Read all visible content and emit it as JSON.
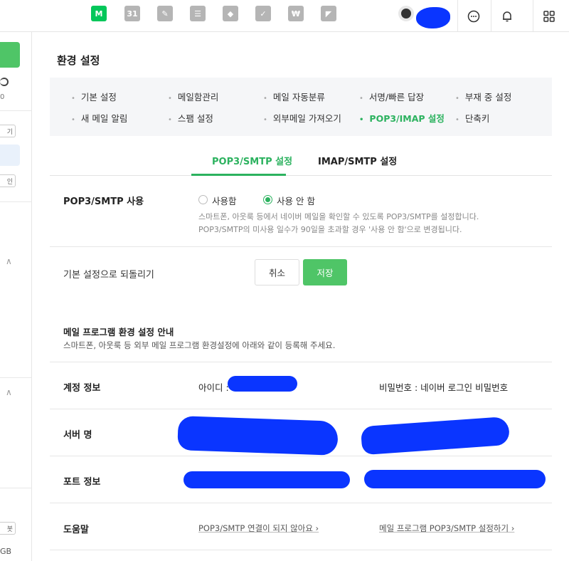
{
  "topbar": {
    "apps": [
      {
        "name": "mail",
        "glyph": "M"
      },
      {
        "name": "calendar",
        "glyph": "31"
      },
      {
        "name": "memo",
        "glyph": "✎"
      },
      {
        "name": "contacts",
        "glyph": "☰"
      },
      {
        "name": "mybox",
        "glyph": "◆"
      },
      {
        "name": "todo",
        "glyph": "✓"
      },
      {
        "name": "pay",
        "glyph": "₩"
      },
      {
        "name": "office",
        "glyph": "◤"
      }
    ],
    "icons": {
      "chat": "chat-icon",
      "bell": "bell-icon",
      "grid": "grid-icon"
    }
  },
  "sidebar": {
    "circle_count": "0",
    "box1": "기",
    "box2": "인",
    "bottom1": "봇",
    "bottom2": "GB"
  },
  "page": {
    "title": "환경 설정"
  },
  "menu": {
    "items": [
      "기본 설정",
      "메일함관리",
      "메일 자동분류",
      "서명/빠른 답장",
      "부재 중 설정",
      "새 메일 알림",
      "스팸 설정",
      "외부메일 가져오기",
      "POP3/IMAP 설정",
      "단축키"
    ]
  },
  "tabs": {
    "pop3": "POP3/SMTP 설정",
    "imap": "IMAP/SMTP 설정"
  },
  "pop3_setting": {
    "label": "POP3/SMTP 사용",
    "option_on": "사용함",
    "option_off": "사용 안 함",
    "desc1": "스마트폰, 아웃룩 등에서 네이버 메일을 확인할 수 있도록 POP3/SMTP를 설정합니다.",
    "desc2": "POP3/SMTP의 미사용 일수가 90일을 초과할 경우 '사용 안 함'으로 변경됩니다."
  },
  "reset": {
    "label": "기본 설정으로 되돌리기",
    "cancel": "취소",
    "save": "저장"
  },
  "guide": {
    "title": "메일 프로그램 환경 설정 안내",
    "desc": "스마트폰, 아웃룩 등 외부 메일 프로그램 환경설정에 아래와 같이 등록해 주세요.",
    "account_label": "계정 정보",
    "id_prefix": "아이디 :",
    "password_info": "비밀번호 : 네이버 로그인 비밀번호",
    "server_label": "서버 명",
    "port_label": "포트 정보",
    "help_label": "도움말",
    "help_link1": "POP3/SMTP 연결이 되지 않아요 ›",
    "help_link2": "메일 프로그램 POP3/SMTP 설정하기 ›"
  },
  "colors": {
    "accent": "#2cb25f",
    "save_button": "#4fc567",
    "scribble": "#0a35ff"
  }
}
